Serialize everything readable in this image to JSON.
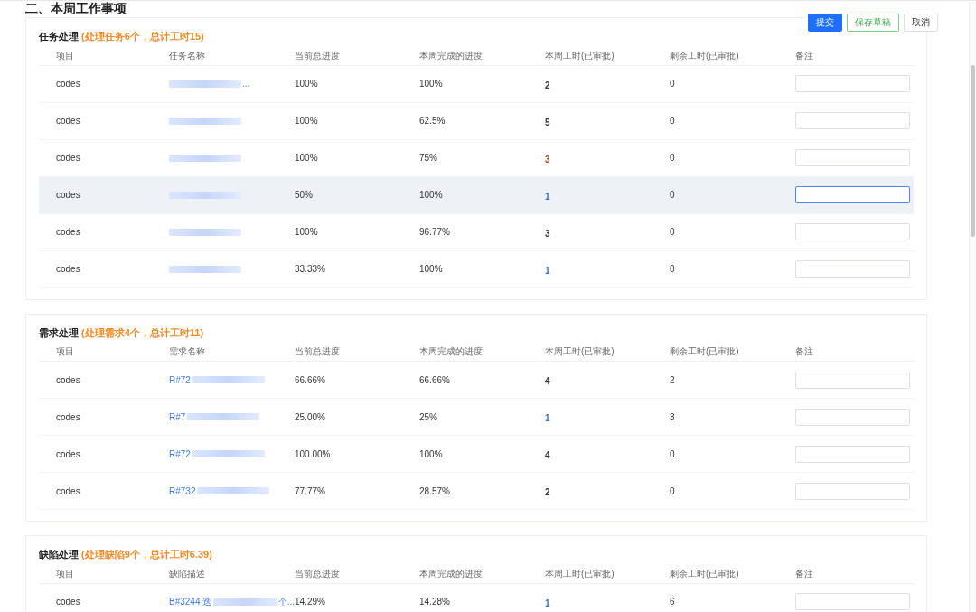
{
  "heading": "二、本周工作事项",
  "buttons": [
    {
      "label": "提交",
      "kind": "primary"
    },
    {
      "label": "保存草稿",
      "kind": "success"
    },
    {
      "label": "取消",
      "kind": "default"
    }
  ],
  "sections": [
    {
      "title": "任务处理",
      "summary": "(处理任务6个，总计工时15)",
      "columns": [
        "项目",
        "任务名称",
        "当前总进度",
        "本周完成的进度",
        "本周工时(已审批)",
        "剩余工时(已审批)",
        "备注"
      ],
      "rows": [
        {
          "project": "codes",
          "name": {
            "suffix": "...",
            "redacted": true
          },
          "total": "100%",
          "week": "100%",
          "hours": "2",
          "color": "#333333",
          "remaining": "0",
          "hovered": false,
          "note_focused": false
        },
        {
          "project": "codes",
          "name": {
            "redacted": true
          },
          "total": "100%",
          "week": "62.5%",
          "hours": "5",
          "color": "#333333",
          "remaining": "0",
          "hovered": false,
          "note_focused": false
        },
        {
          "project": "codes",
          "name": {
            "redacted": true
          },
          "total": "100%",
          "week": "75%",
          "hours": "3",
          "color": "#c0392b",
          "remaining": "0",
          "hovered": false,
          "note_focused": false
        },
        {
          "project": "codes",
          "name": {
            "redacted": true
          },
          "total": "50%",
          "week": "100%",
          "hours": "1",
          "color": "#2f6fd6",
          "remaining": "0",
          "hovered": true,
          "note_focused": true
        },
        {
          "project": "codes",
          "name": {
            "redacted": true
          },
          "total": "100%",
          "week": "96.77%",
          "hours": "3",
          "color": "#333333",
          "remaining": "0",
          "hovered": false,
          "note_focused": false
        },
        {
          "project": "codes",
          "name": {
            "redacted": true
          },
          "total": "33.33%",
          "week": "100%",
          "hours": "1",
          "color": "#2f6fd6",
          "remaining": "0",
          "hovered": false,
          "note_focused": false
        }
      ]
    },
    {
      "title": "需求处理",
      "summary": "(处理需求4个，总计工时11)",
      "columns": [
        "项目",
        "需求名称",
        "当前总进度",
        "本周完成的进度",
        "本周工时(已审批)",
        "剩余工时(已审批)",
        "备注"
      ],
      "rows": [
        {
          "project": "codes",
          "name": {
            "prefix": "R#72",
            "redacted": true
          },
          "total": "66.66%",
          "week": "66.66%",
          "hours": "4",
          "color": "#333333",
          "remaining": "2",
          "hovered": false,
          "note_focused": false
        },
        {
          "project": "codes",
          "name": {
            "prefix": "R#7",
            "redacted": true
          },
          "total": "25.00%",
          "week": "25%",
          "hours": "1",
          "color": "#2f6fd6",
          "remaining": "3",
          "hovered": false,
          "note_focused": false
        },
        {
          "project": "codes",
          "name": {
            "prefix": "R#72",
            "redacted": true
          },
          "total": "100.00%",
          "week": "100%",
          "hours": "4",
          "color": "#333333",
          "remaining": "0",
          "hovered": false,
          "note_focused": false
        },
        {
          "project": "codes",
          "name": {
            "prefix": "R#732",
            "redacted": true
          },
          "total": "77.77%",
          "week": "28.57%",
          "hours": "2",
          "color": "#333333",
          "remaining": "0",
          "hovered": false,
          "note_focused": false
        }
      ]
    },
    {
      "title": "缺陷处理",
      "summary": "(处理缺陷9个，总计工时6.39)",
      "columns": [
        "项目",
        "缺陷描述",
        "当前总进度",
        "本周完成的进度",
        "本周工时(已审批)",
        "剩余工时(已审批)",
        "备注"
      ],
      "rows": [
        {
          "project": "codes",
          "name": {
            "prefix": "B#3244 迭",
            "suffix": "个...",
            "redacted": true
          },
          "total": "14.29%",
          "week": "14.28%",
          "hours": "1",
          "color": "#2f6fd6",
          "remaining": "6",
          "hovered": false,
          "note_focused": false
        }
      ]
    }
  ]
}
